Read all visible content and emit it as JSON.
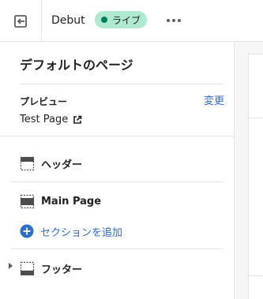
{
  "header": {
    "theme_name": "Debut",
    "status_badge": "ライブ",
    "exit_icon": "exit-icon",
    "more_icon": "more-horizontal-icon"
  },
  "sidebar": {
    "page_title": "デフォルトのページ",
    "preview": {
      "label": "プレビュー",
      "change_label": "変更",
      "page_name": "Test Page",
      "external_icon": "external-link-icon"
    },
    "sections": [
      {
        "label": "ヘッダー",
        "icon": "header-layout-icon"
      },
      {
        "label": "Main Page",
        "icon": "template-layout-icon"
      },
      {
        "label": "フッター",
        "icon": "footer-layout-icon"
      }
    ],
    "add_section_label": "セクションを追加"
  },
  "colors": {
    "accent": "#2c6ecb",
    "badge_bg": "#aee9d1",
    "badge_dot": "#007f5f",
    "border": "#e1e3e5",
    "canvas_bg": "#f6f6f7"
  }
}
